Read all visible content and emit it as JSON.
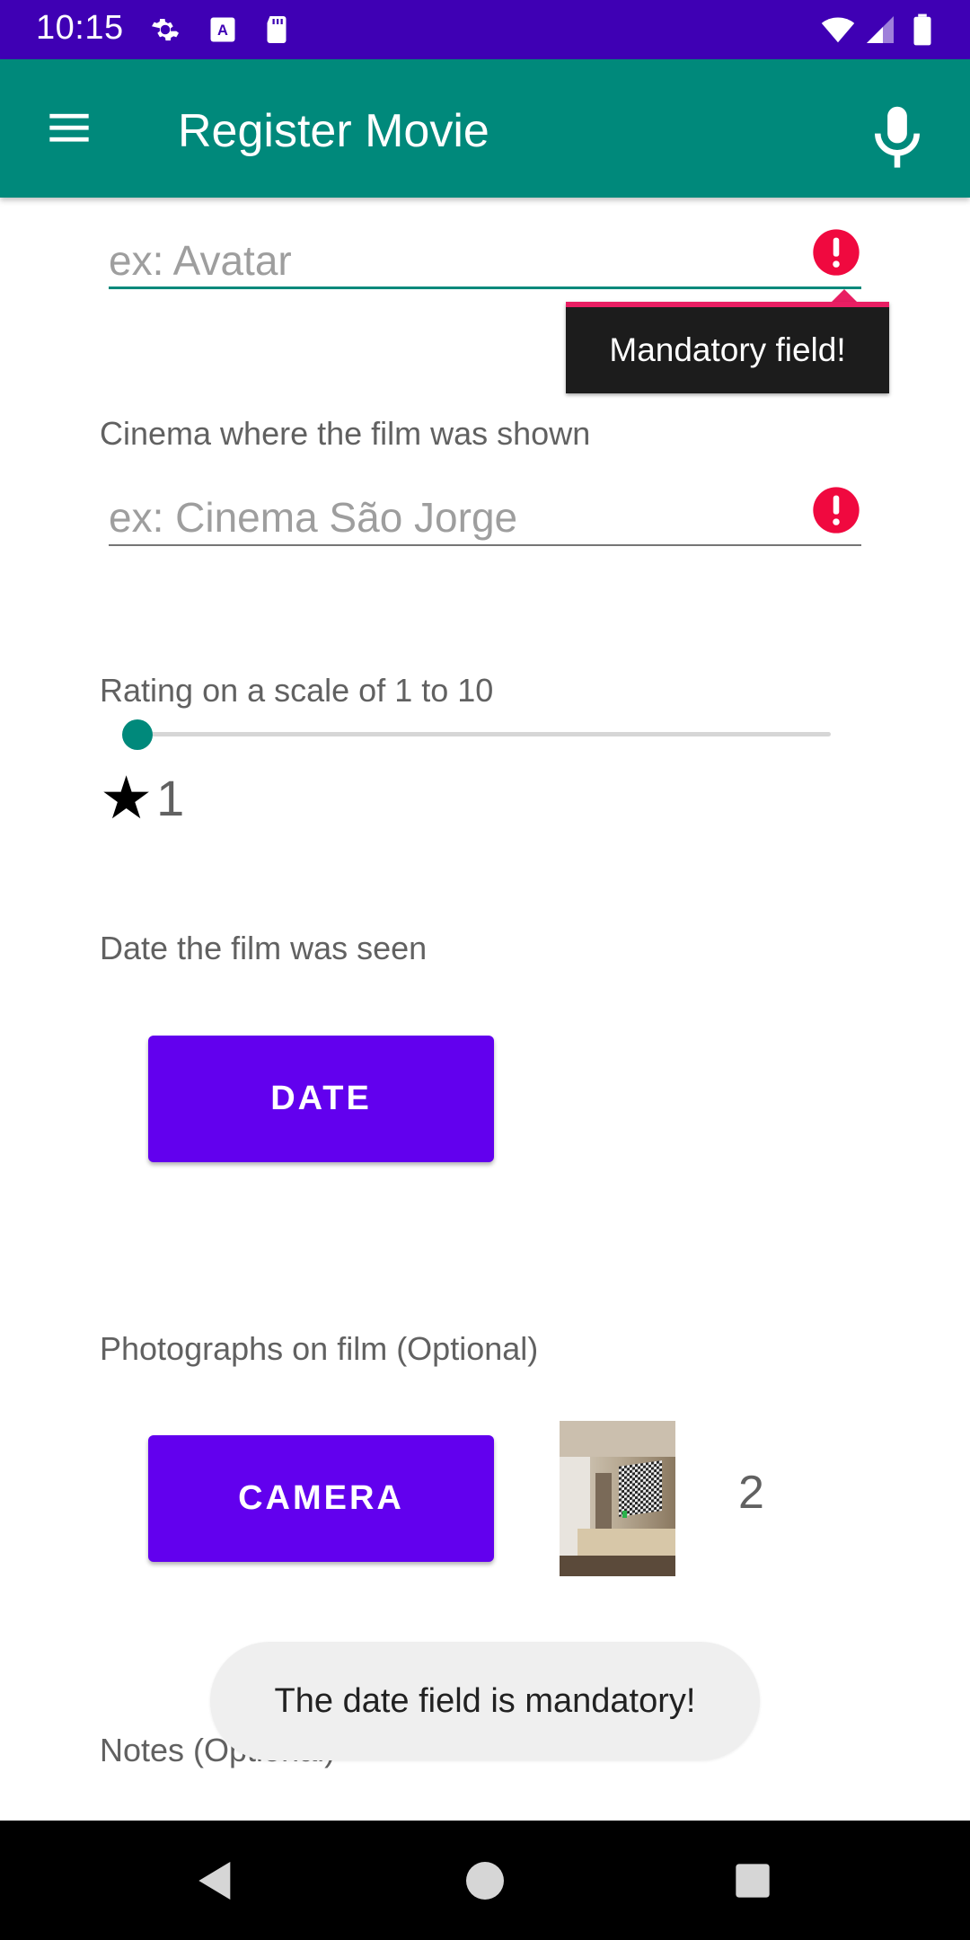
{
  "status_bar": {
    "time": "10:15",
    "icons": [
      "gear-icon",
      "keyboard-icon",
      "sd-card-icon",
      "wifi-icon",
      "signal-icon",
      "battery-icon"
    ]
  },
  "app_bar": {
    "title": "Register Movie",
    "color": "#00897b",
    "menu_icon": "hamburger-menu-icon",
    "mic_icon": "microphone-icon"
  },
  "form": {
    "title_field": {
      "value": "",
      "placeholder": "ex: Avatar",
      "error_tooltip": "Mandatory field!"
    },
    "cinema_field": {
      "label": "Cinema where the film was shown",
      "value": "",
      "placeholder": "ex: Cinema São Jorge"
    },
    "rating": {
      "label": "Rating on a scale of 1 to 10",
      "value": "1",
      "min": 1,
      "max": 10
    },
    "date": {
      "label": "Date the film was seen",
      "button_label": "DATE"
    },
    "photos": {
      "label": "Photographs on film (Optional)",
      "button_label": "CAMERA",
      "count": "2"
    },
    "notes": {
      "label": "Notes (Optional)"
    }
  },
  "toast": {
    "message": "The date field is mandatory!"
  },
  "colors": {
    "accent": "#00897b",
    "button": "#6200ee",
    "error": "#e91e63",
    "status_bar": "#3f00b4"
  }
}
